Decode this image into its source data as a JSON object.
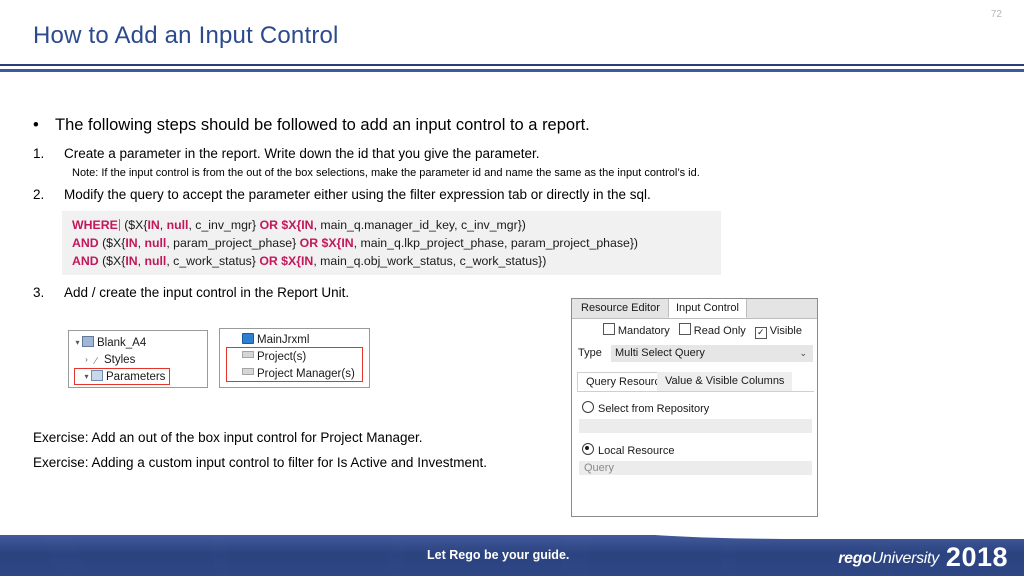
{
  "slide": {
    "page_number": "72",
    "title": "How to Add an Input Control",
    "accent_color": "#2c4a8c",
    "rule_color": "#3b5aa6"
  },
  "content": {
    "lead_bullet": {
      "marker": "•",
      "text": "The following steps should be followed to add an input control to a report."
    },
    "steps": [
      {
        "marker": "1.",
        "text": "Create a parameter in the report. Write down the id that you give the parameter."
      },
      {
        "marker": "2.",
        "text": "Modify the query to accept the parameter either using the filter expression tab or directly in the sql."
      },
      {
        "marker": "3.",
        "text": "Add / create the input control in the Report Unit."
      }
    ],
    "note": "Note: If the input control is from the out of the box selections, make the parameter id and name the same as the input control’s id.",
    "exercises": [
      "Exercise: Add an out of the box input control for Project Manager.",
      "Exercise: Adding a custom input control to filter for Is Active and Investment."
    ]
  },
  "code_block": {
    "background": "#f1f1f1",
    "keyword_color": "#c2185b",
    "lines": [
      {
        "segments": [
          {
            "t": "WHERE",
            "k": "kw"
          },
          {
            "t": "caret",
            "k": "caret"
          },
          {
            "t": " ($X{",
            "k": "plain"
          },
          {
            "t": "IN",
            "k": "kw"
          },
          {
            "t": ", ",
            "k": "plain"
          },
          {
            "t": "null",
            "k": "kw"
          },
          {
            "t": ", c_inv_mgr} ",
            "k": "plain"
          },
          {
            "t": "OR $X{IN",
            "k": "kw"
          },
          {
            "t": ", main_q.manager_id_key, c_inv_mgr})",
            "k": "plain"
          }
        ]
      },
      {
        "segments": [
          {
            "t": "AND",
            "k": "kw"
          },
          {
            "t": " ($X{",
            "k": "plain"
          },
          {
            "t": "IN",
            "k": "kw"
          },
          {
            "t": ", ",
            "k": "plain"
          },
          {
            "t": "null",
            "k": "kw"
          },
          {
            "t": ", param_project_phase} ",
            "k": "plain"
          },
          {
            "t": "OR $X{IN",
            "k": "kw"
          },
          {
            "t": ", main_q.lkp_project_phase, param_project_phase})",
            "k": "plain"
          }
        ]
      },
      {
        "segments": [
          {
            "t": "AND",
            "k": "kw"
          },
          {
            "t": " ($X{",
            "k": "plain"
          },
          {
            "t": "IN",
            "k": "kw"
          },
          {
            "t": ", ",
            "k": "plain"
          },
          {
            "t": "null",
            "k": "kw"
          },
          {
            "t": ", c_work_status} ",
            "k": "plain"
          },
          {
            "t": "OR $X{IN",
            "k": "kw"
          },
          {
            "t": ", main_q.obj_work_status, c_work_status})",
            "k": "plain"
          }
        ]
      }
    ]
  },
  "tree_left": {
    "rows": [
      {
        "twisty": "▾",
        "icon": "document-icon",
        "label": "Blank_A4",
        "indent": 0,
        "highlight": false
      },
      {
        "twisty": "›",
        "icon": "styles-icon",
        "label": "Styles",
        "indent": 1,
        "highlight": false
      },
      {
        "twisty": "▾",
        "icon": "parameters-icon",
        "label": "Parameters",
        "indent": 1,
        "highlight": true
      }
    ]
  },
  "tree_right": {
    "rows": [
      {
        "twisty": "",
        "icon": "jrxml-icon",
        "label": "MainJrxml",
        "indent": 1,
        "highlight": false
      },
      {
        "twisty": "",
        "icon": "control-icon",
        "label": "Project(s)",
        "indent": 1,
        "highlight": true
      },
      {
        "twisty": "",
        "icon": "control-icon",
        "label": "Project Manager(s)",
        "indent": 1,
        "highlight": true
      }
    ],
    "highlight_color": "#e2352b"
  },
  "dialog": {
    "tabs": [
      {
        "label": "Resource Editor",
        "active": false
      },
      {
        "label": "Input Control",
        "active": true
      }
    ],
    "checkboxes": [
      {
        "label": "Mandatory",
        "checked": false
      },
      {
        "label": "Read Only",
        "checked": false
      },
      {
        "label": "Visible",
        "checked": true
      }
    ],
    "type_label": "Type",
    "type_value": "Multi Select Query",
    "combo_arrow": "⌄",
    "subtabs": [
      {
        "label": "Query Resource",
        "active": true
      },
      {
        "label": "Value & Visible Columns",
        "active": false
      }
    ],
    "radios": [
      {
        "label": "Select from Repository",
        "selected": false
      },
      {
        "label": "Local Resource",
        "selected": true
      }
    ],
    "repository_field_value": "",
    "query_field_placeholder": "Query"
  },
  "footer": {
    "tagline": "Let Rego be your guide.",
    "logo_rego": "rego",
    "logo_university": "University",
    "logo_year": "2018",
    "background": "#2e4684"
  }
}
